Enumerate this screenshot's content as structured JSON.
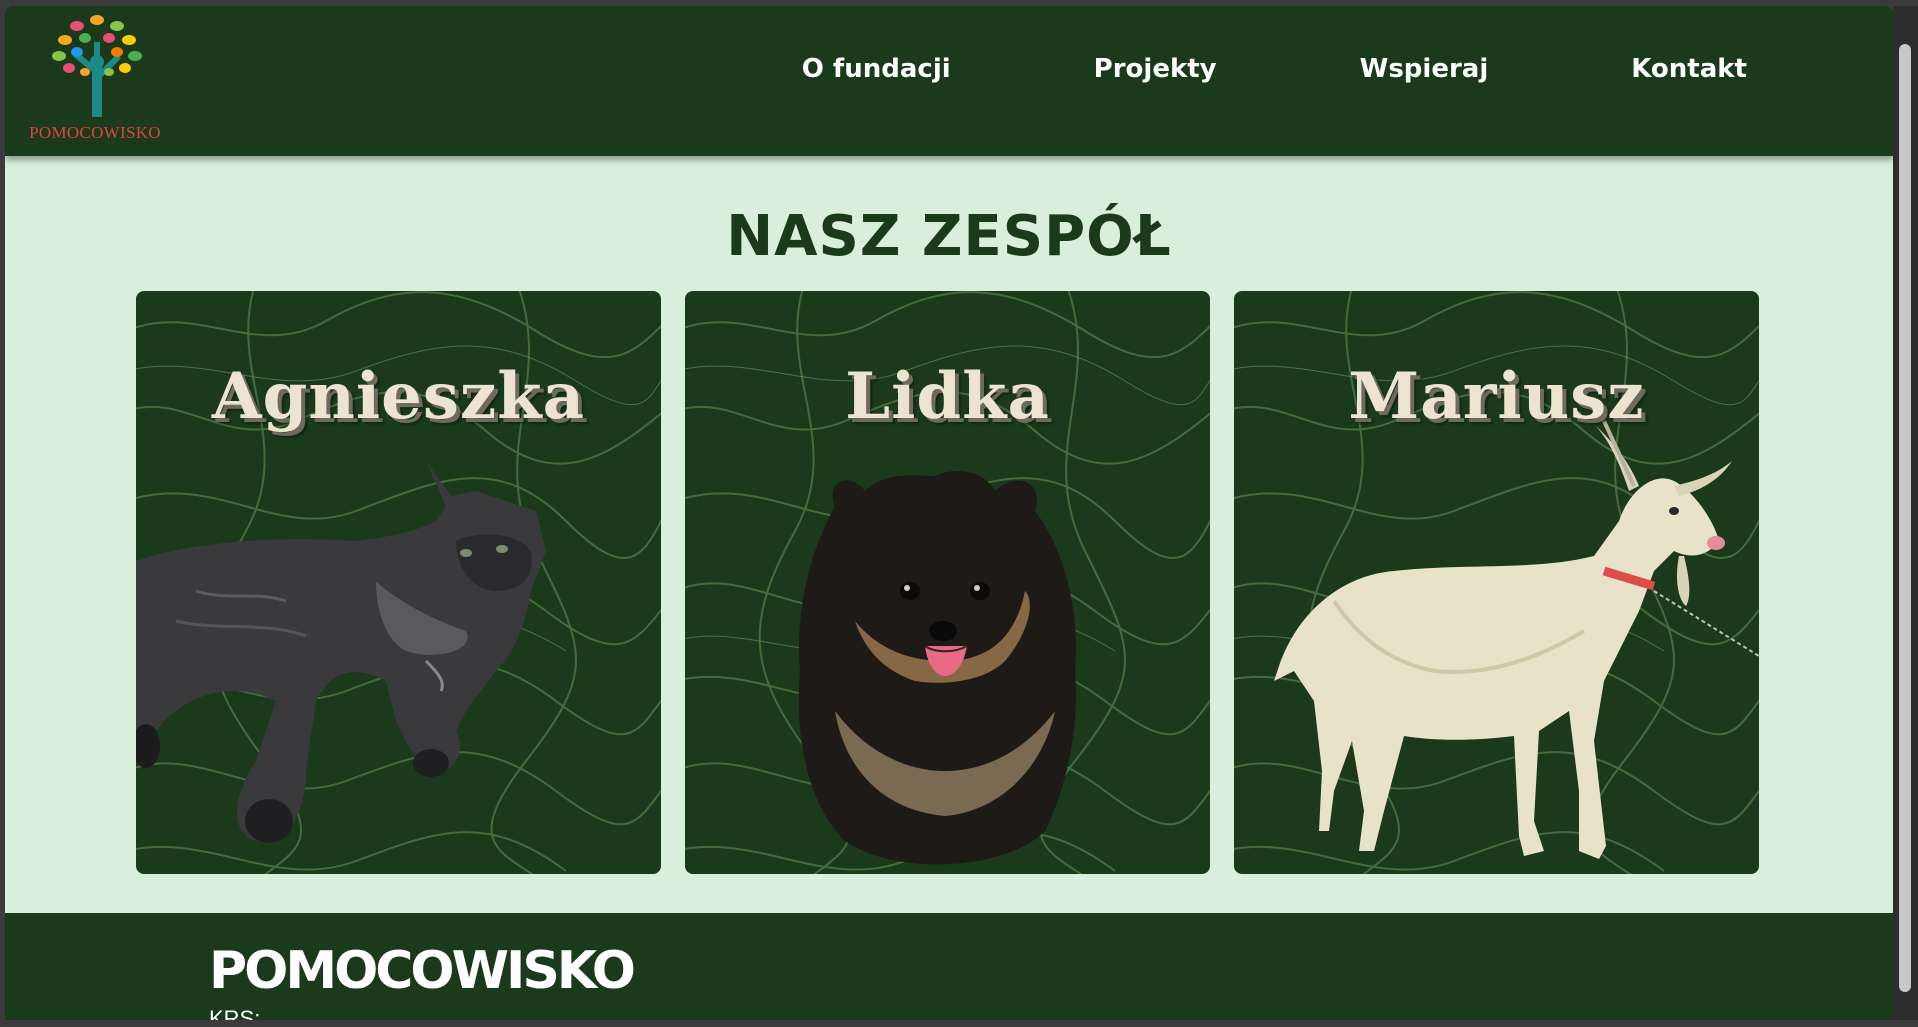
{
  "logo": {
    "text": "POMOCOWISKO"
  },
  "nav": {
    "items": [
      {
        "label": "O fundacji"
      },
      {
        "label": "Projekty"
      },
      {
        "label": "Wspieraj"
      },
      {
        "label": "Kontakt"
      }
    ]
  },
  "team": {
    "title": "NASZ ZESPÓŁ",
    "members": [
      {
        "name": "Agnieszka",
        "animal": "cat"
      },
      {
        "name": "Lidka",
        "animal": "dog"
      },
      {
        "name": "Mariusz",
        "animal": "goat"
      }
    ]
  },
  "footer": {
    "brand": "POMOCOWISKO",
    "krs_label": "KRS:"
  },
  "colors": {
    "primary": "#1b3a1c",
    "background": "#d9eedb",
    "accent": "#e0414b",
    "name_text": "#ece3d0"
  }
}
